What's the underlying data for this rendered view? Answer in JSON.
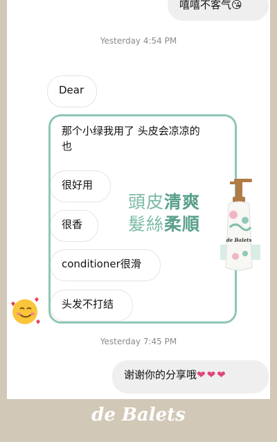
{
  "chat": {
    "top_partial_text": "嘻嘻不客气😘",
    "timestamp_1": "Yesterday 4:54 PM",
    "messages": [
      "Dear",
      "那个小绿我用了 头皮会凉凉的",
      "也",
      "很好用",
      "很香",
      "conditioner很滑",
      "头发不打结"
    ],
    "timestamp_2": "Yesterday 7:45 PM",
    "reply": "谢谢你的分享哦",
    "reply_hearts": "❤❤❤"
  },
  "promo": {
    "line1_a": "頭皮",
    "line1_b": "清爽",
    "line2_a": "髮絲",
    "line2_b": "柔順"
  },
  "product_label": "de Balets",
  "footer_brand": "de Balets",
  "colors": {
    "accent_green": "#8cc6b8",
    "background": "#d2c8b8",
    "heart": "#e0467a"
  }
}
